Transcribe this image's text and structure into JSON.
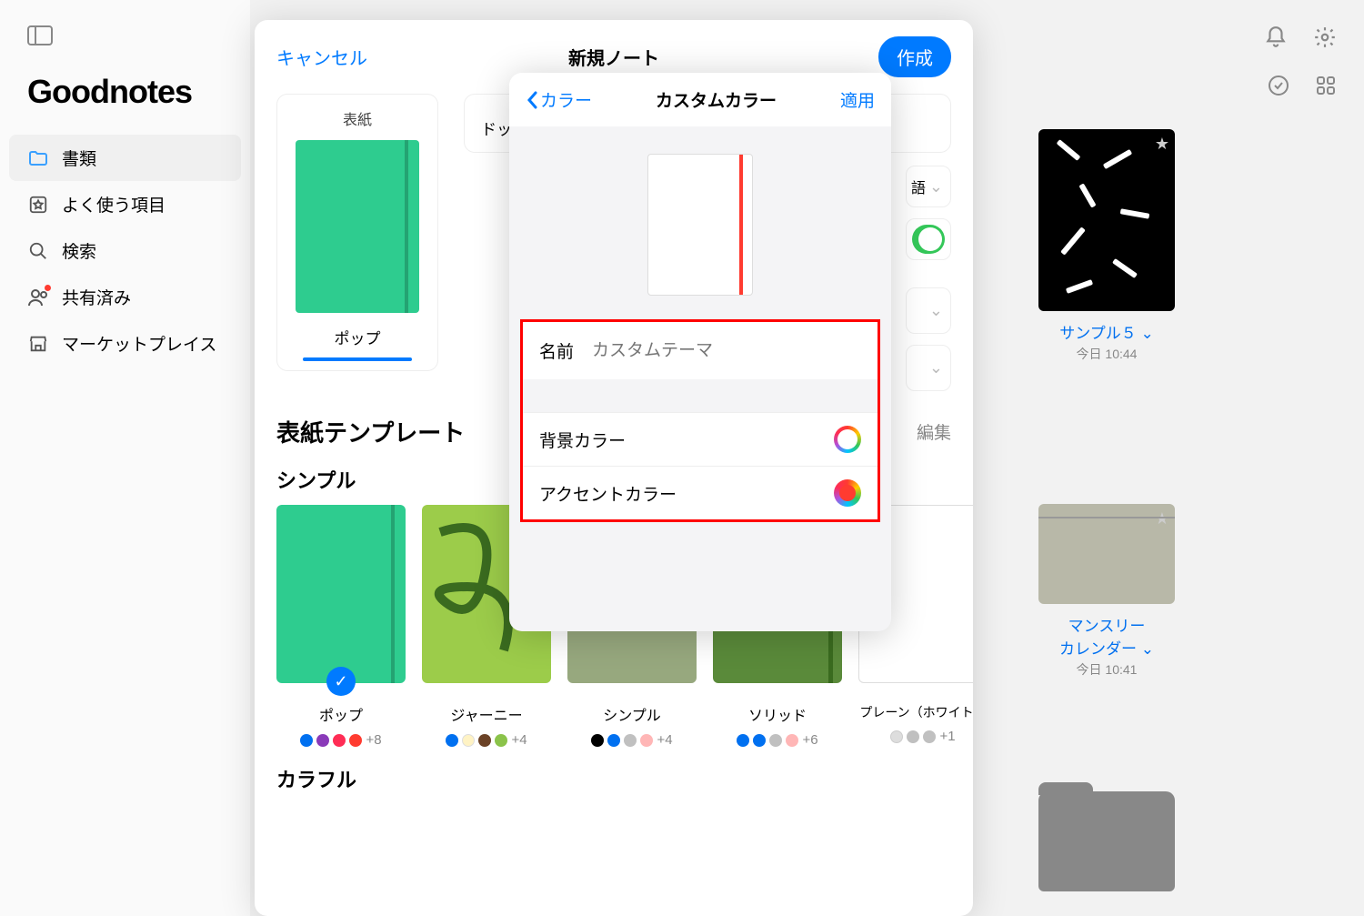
{
  "app_title": "Goodnotes",
  "sidebar": {
    "documents": "書類",
    "favorites": "よく使う項目",
    "search": "検索",
    "shared": "共有済み",
    "marketplace": "マーケットプレイス"
  },
  "bg": {
    "sample5_title": "サンプル５",
    "sample5_time": "今日 10:44",
    "monthly_title": "マンスリー\nカレンダー",
    "monthly_time": "今日 10:41",
    "chevron": "⌄"
  },
  "modal": {
    "cancel": "キャンセル",
    "title": "新規ノート",
    "create": "作成",
    "cover_tab_top": "表紙",
    "cover_tab_bottom": "ポップ",
    "paper_tab_bottom": "ドッ",
    "lang_suffix": "語",
    "section_title": "表紙テンプレート",
    "edit": "編集",
    "sub_simple": "シンプル",
    "sub_colorful": "カラフル",
    "templates": [
      {
        "name": "ポップ",
        "more": "+8",
        "bg": "#2ecc8f",
        "selected": true
      },
      {
        "name": "ジャーニー",
        "more": "+4",
        "bg": "#8bc34a"
      },
      {
        "name": "シンプル",
        "more": "+4",
        "bg": "#97a87e"
      },
      {
        "name": "ソリッド",
        "more": "+6",
        "bg": "#6b8e23"
      },
      {
        "name": "プレーン（ホワイト）",
        "more": "+1",
        "bg": "#ffffff"
      }
    ],
    "swatch_sets": {
      "pop": [
        "#0070f0",
        "#8a3ab9",
        "#ff2d55",
        "#ff3b30"
      ],
      "journey": [
        "#0070f0",
        "#fff3c4",
        "#6b4226",
        "#8bc34a"
      ],
      "simple": [
        "#000000",
        "#0070f0",
        "#c0c0c0",
        "#ffb6b6"
      ],
      "solid": [
        "#0070f0",
        "#0070f0",
        "#c0c0c0",
        "#ffb6b6"
      ],
      "plain": [
        "#c0c0c0",
        "#c0c0c0",
        "#c0c0c0"
      ]
    }
  },
  "popover": {
    "back": "カラー",
    "title": "カスタムカラー",
    "apply": "適用",
    "name_label": "名前",
    "name_placeholder": "カスタムテーマ",
    "bg_color": "背景カラー",
    "accent_color": "アクセントカラー"
  }
}
